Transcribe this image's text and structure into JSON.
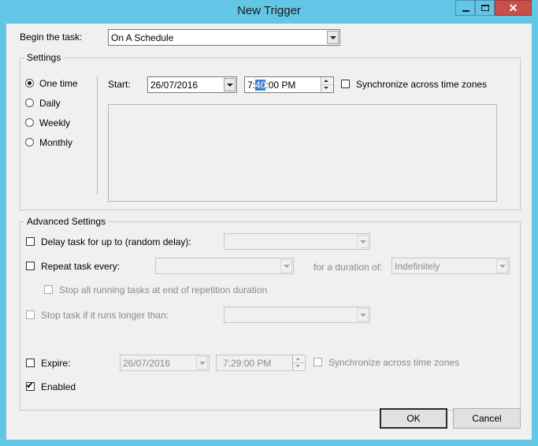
{
  "window": {
    "title": "New Trigger",
    "controls": {
      "minimize": "minimize-icon",
      "maximize": "maximize-icon",
      "close": "close-icon"
    }
  },
  "begin_task": {
    "label": "Begin the task:",
    "value": "On A Schedule"
  },
  "settings": {
    "legend": "Settings",
    "schedule_options": [
      {
        "label": "One time",
        "selected": true
      },
      {
        "label": "Daily",
        "selected": false
      },
      {
        "label": "Weekly",
        "selected": false
      },
      {
        "label": "Monthly",
        "selected": false
      }
    ],
    "start_label": "Start:",
    "start_date": "26/07/2016",
    "start_time": {
      "hour": "7:",
      "minute": "40",
      "rest": ":00 PM"
    },
    "sync_time_zones": {
      "label": "Synchronize across time zones",
      "checked": false
    }
  },
  "advanced": {
    "legend": "Advanced Settings",
    "delay": {
      "label": "Delay task for up to (random delay):",
      "checked": false,
      "value": ""
    },
    "repeat": {
      "label": "Repeat task every:",
      "checked": false,
      "value": "",
      "duration_label": "for a duration of:",
      "duration_value": "Indefinitely"
    },
    "stop_repetition": {
      "label": "Stop all running tasks at end of repetition duration",
      "checked": false
    },
    "stop_longer": {
      "label": "Stop task if it runs longer than:",
      "checked": false,
      "value": ""
    },
    "expire": {
      "label": "Expire:",
      "checked": false,
      "date": "26/07/2016",
      "time": "7:29:00 PM",
      "sync_label": "Synchronize across time zones",
      "sync_checked": false
    },
    "enabled": {
      "label": "Enabled",
      "checked": true,
      "mark": "✔"
    }
  },
  "buttons": {
    "ok": "OK",
    "cancel": "Cancel"
  }
}
